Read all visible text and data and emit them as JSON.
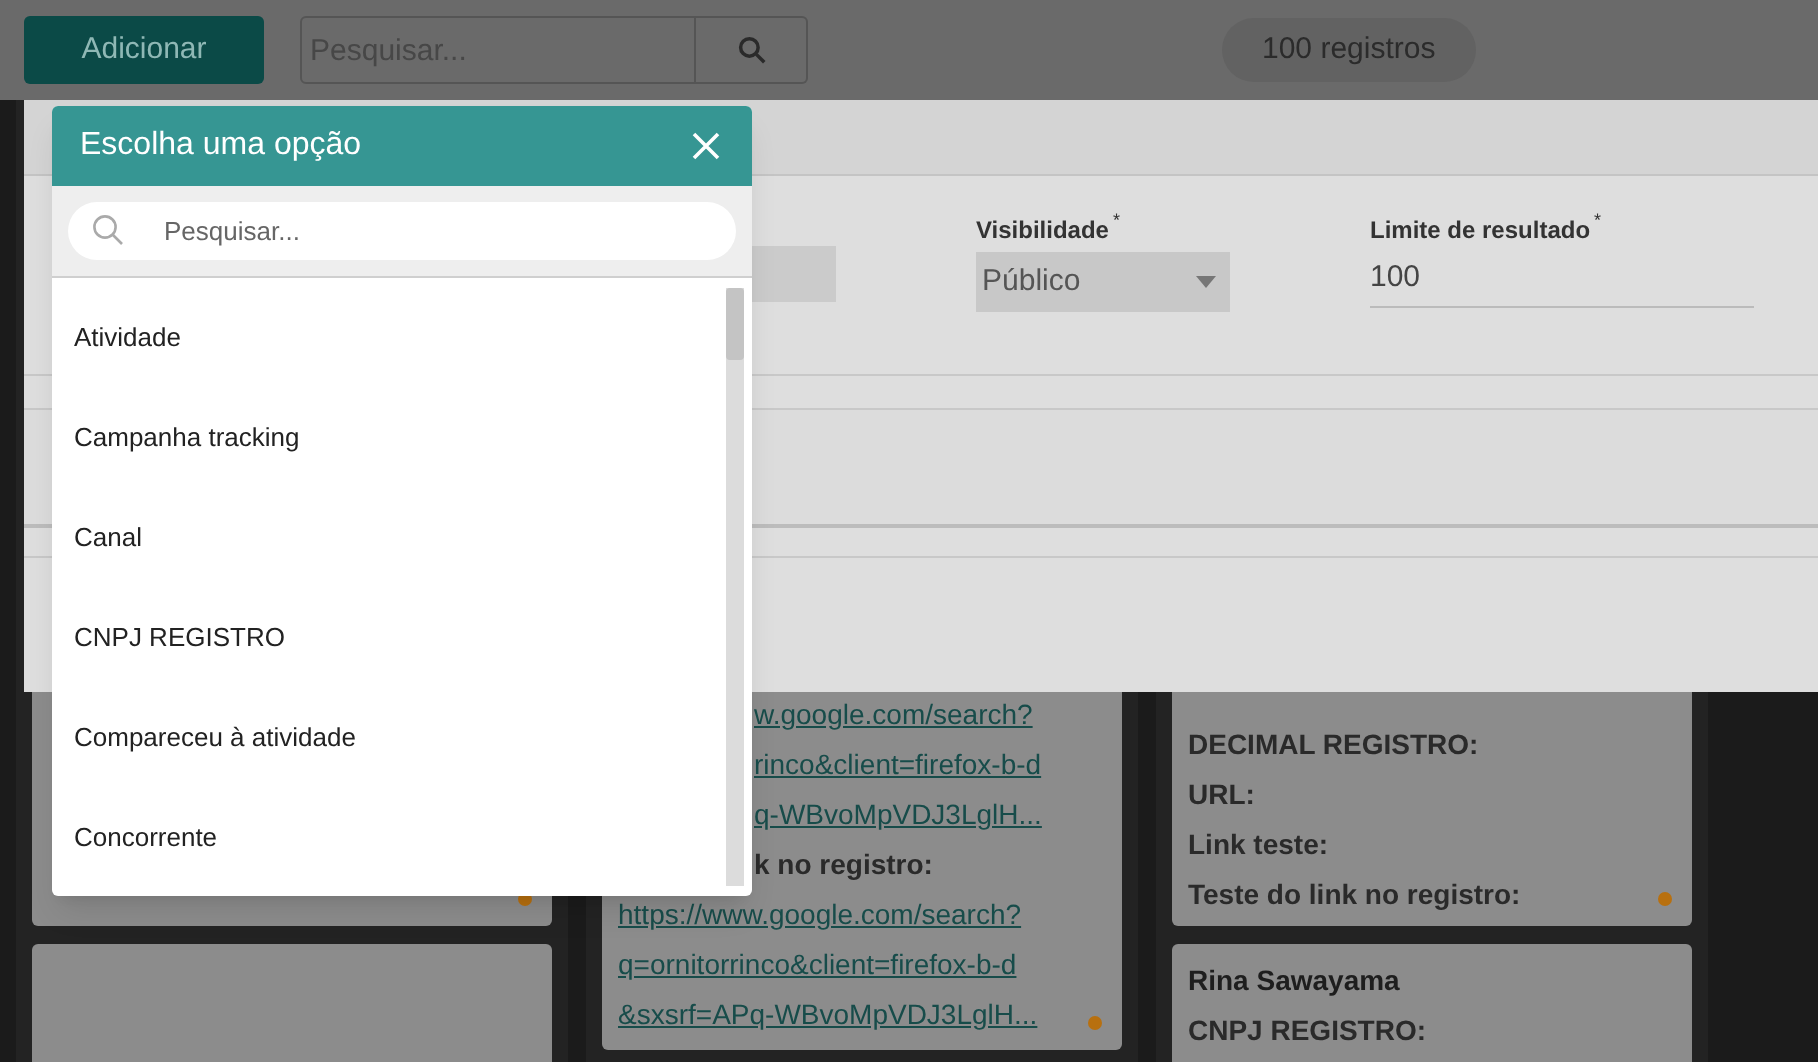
{
  "toolbar": {
    "add_button": "Adicionar",
    "search": {
      "placeholder": "Pesquisar..."
    },
    "count_badge": "100 registros"
  },
  "board": {
    "columns": [
      {
        "cards": [
          {
            "kind": "record",
            "marker": true
          },
          {
            "kind": "record"
          }
        ]
      },
      {
        "cards": [
          {
            "kind": "record",
            "marker": true,
            "lines": [
              {
                "kind": "partial_link",
                "text": "w.google.com/search?"
              },
              {
                "kind": "partial_link",
                "text": "rinco&client=firefox-b-d"
              },
              {
                "kind": "partial_link",
                "text": "q-WBvoMpVDJ3LglH..."
              },
              {
                "kind": "partial_label",
                "text": "k no registro:"
              },
              {
                "kind": "link",
                "text": "https://www.google.com/search?"
              },
              {
                "kind": "link",
                "text": "q=ornitorrinco&client=firefox-b-d"
              },
              {
                "kind": "link",
                "text": "&sxsrf=APq-WBvoMpVDJ3LglH..."
              }
            ]
          }
        ]
      },
      {
        "cards": [
          {
            "kind": "record",
            "marker": true,
            "lines": [
              {
                "kind": "label",
                "text": "DECIMAL REGISTRO:"
              },
              {
                "kind": "label",
                "text": "URL:"
              },
              {
                "kind": "label",
                "text": "Link teste:"
              },
              {
                "kind": "label",
                "text": "Teste do link no registro:"
              }
            ]
          },
          {
            "kind": "record",
            "title": "Rina Sawayama",
            "lines": [
              {
                "kind": "label",
                "text": "CNPJ REGISTRO:"
              }
            ]
          }
        ]
      }
    ]
  },
  "modal": {
    "fields": [
      {
        "kind": "select",
        "label": "Visibilidade",
        "required_mark": "*",
        "value": "Público"
      },
      {
        "kind": "input",
        "label": "Limite de resultado",
        "required_mark": "*",
        "value": "100"
      }
    ]
  },
  "picker": {
    "title": "Escolha uma opção",
    "search": {
      "placeholder": "Pesquisar..."
    },
    "options": [
      {
        "label": "Atividade",
        "selected": false
      },
      {
        "label": "Campanha tracking",
        "selected": false
      },
      {
        "label": "Canal",
        "selected": false
      },
      {
        "label": "CNPJ REGISTRO",
        "selected": false
      },
      {
        "label": "Compareceu à atividade",
        "selected": false
      },
      {
        "label": "Concorrente",
        "selected": false
      }
    ]
  }
}
